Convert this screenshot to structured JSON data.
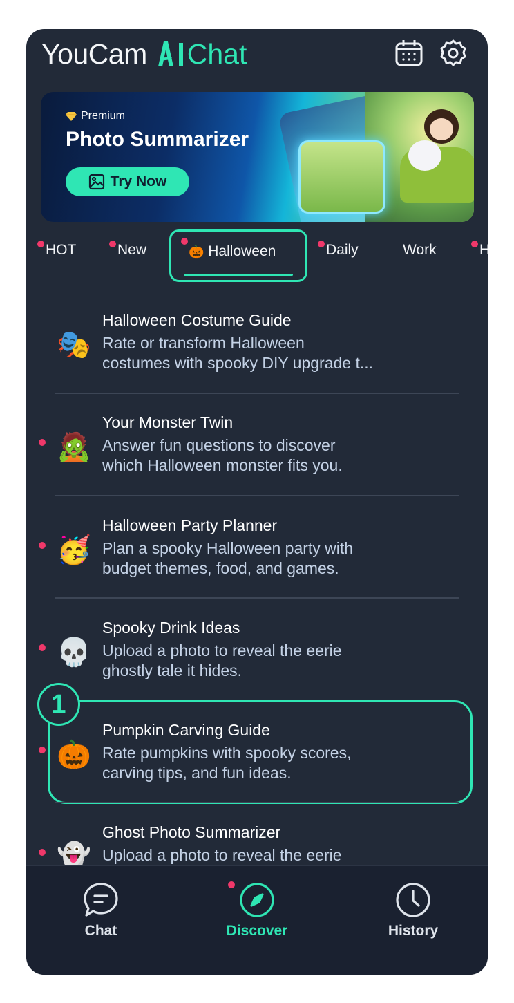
{
  "header": {
    "logo_text": "YouCam",
    "logo_ai_text": "Chat",
    "logo_ai_mark": "AI",
    "calendar_icon": "calendar-icon",
    "settings_icon": "gear-icon"
  },
  "banner": {
    "badge": "Premium",
    "title": "Photo Summarizer",
    "cta": "Try Now"
  },
  "tabs": [
    {
      "label": "HOT",
      "dot": true
    },
    {
      "label": "New",
      "dot": true
    },
    {
      "label": "Halloween",
      "dot": true,
      "active": true,
      "emoji": "🎃"
    },
    {
      "label": "Daily",
      "dot": true
    },
    {
      "label": "Work",
      "dot": false
    },
    {
      "label": "H",
      "dot": true
    }
  ],
  "items": [
    {
      "title": "Halloween Costume Guide",
      "desc1": "Rate or transform Halloween",
      "desc2": "costumes with spooky DIY upgrade t...",
      "emoji": "🎭",
      "dot": false
    },
    {
      "title": "Your Monster Twin",
      "desc1": "Answer fun questions to discover",
      "desc2": "which Halloween monster fits you.",
      "emoji": "🧟",
      "dot": true
    },
    {
      "title": "Halloween Party Planner",
      "desc1": "Plan a spooky Halloween party with",
      "desc2": "budget themes, food, and games.",
      "emoji": "🥳",
      "dot": true
    },
    {
      "title": "Spooky Drink Ideas",
      "desc1": "Upload a photo to reveal the eerie",
      "desc2": "ghostly tale it hides.",
      "emoji": "💀",
      "dot": true
    },
    {
      "title": "Pumpkin Carving Guide",
      "desc1": "Rate pumpkins with spooky scores,",
      "desc2": "carving tips, and fun ideas.",
      "emoji": "🎃",
      "dot": true
    },
    {
      "title": "Ghost Photo Summarizer",
      "desc1": "Upload a photo to reveal the eerie",
      "desc2": "",
      "emoji": "👻",
      "dot": true
    }
  ],
  "step_badge": "1",
  "bottom_nav": [
    {
      "label": "Chat",
      "icon": "chat-bubble-icon"
    },
    {
      "label": "Discover",
      "icon": "compass-icon",
      "active": true
    },
    {
      "label": "History",
      "icon": "clock-icon"
    }
  ],
  "colors": {
    "background": "#222a38",
    "accent": "#2fe6b4",
    "dot": "#f0386a",
    "desc_text": "#c4d2e6"
  }
}
